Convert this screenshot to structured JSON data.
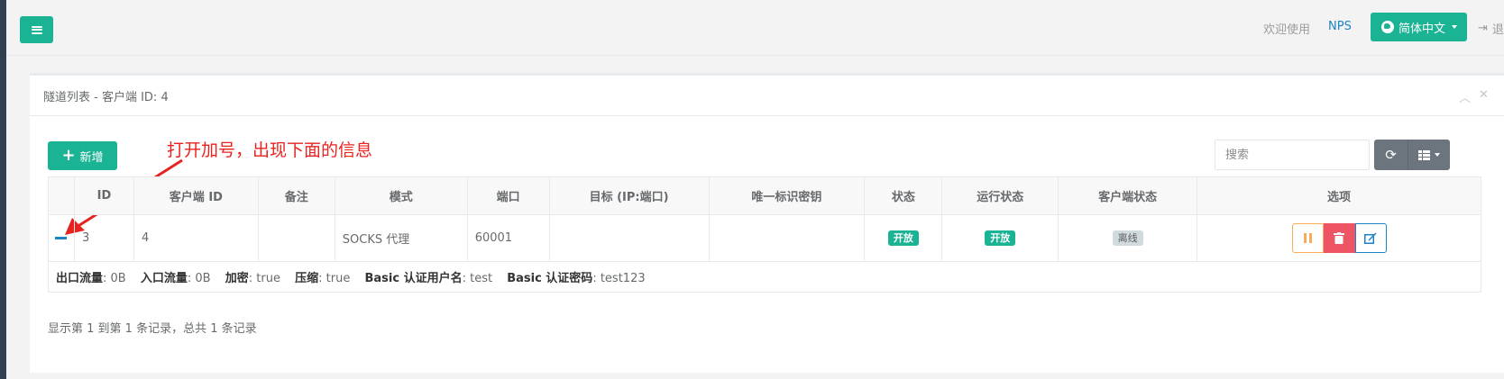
{
  "header": {
    "welcome": "欢迎使用",
    "app_name": "NPS",
    "language_label": "简体中文",
    "logout_label": "退出"
  },
  "panel": {
    "title": "隧道列表 - 客户端 ID: 4",
    "collapse_icon": "chevron-up-icon",
    "close_icon": "close-icon"
  },
  "toolbar": {
    "add_label": "新增",
    "search_placeholder": "搜索"
  },
  "annotation": {
    "text": "打开加号，出现下面的信息",
    "color": "#e8231f"
  },
  "table": {
    "headers": [
      "",
      "ID",
      "客户端 ID",
      "备注",
      "模式",
      "端口",
      "目标 (IP:端口)",
      "唯一标识密钥",
      "状态",
      "运行状态",
      "客户端状态",
      "选项"
    ],
    "rows": [
      {
        "id": "3",
        "client_id": "4",
        "remark": "",
        "mode": "SOCKS 代理",
        "port": "60001",
        "target": "",
        "key": "",
        "status": "开放",
        "run_status": "开放",
        "client_status": "离线"
      }
    ],
    "detail": [
      {
        "label": "出口流量",
        "value": "0B"
      },
      {
        "label": "入口流量",
        "value": "0B"
      },
      {
        "label": "加密",
        "value": "true"
      },
      {
        "label": "压缩",
        "value": "true"
      },
      {
        "label": "Basic 认证用户名",
        "value": "test"
      },
      {
        "label": "Basic 认证密码",
        "value": "test123"
      }
    ]
  },
  "pagination": {
    "summary": "显示第 1 到第 1 条记录，总共 1 条记录"
  },
  "colors": {
    "primary": "#1ab394",
    "link": "#1c84c6",
    "warning": "#f8ac59",
    "danger": "#ed5565"
  }
}
